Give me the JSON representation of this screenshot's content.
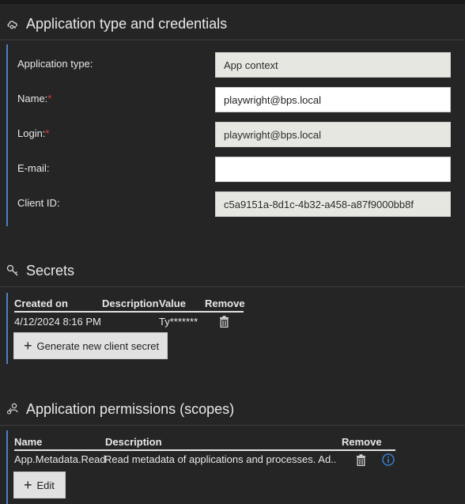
{
  "credentials": {
    "section_title": "Application type and credentials",
    "app_type_label": "Application type:",
    "app_type_value": "App context",
    "name_label": "Name:",
    "name_value": "playwright@bps.local",
    "login_label": "Login:",
    "login_value": "playwright@bps.local",
    "email_label": "E-mail:",
    "email_value": "",
    "client_id_label": "Client ID:",
    "client_id_value": "c5a9151a-8d1c-4b32-a458-a87f9000bb8f",
    "required_marker": "*"
  },
  "secrets": {
    "section_title": "Secrets",
    "columns": [
      "Created on",
      "Description",
      "Value",
      "Remove"
    ],
    "rows": [
      {
        "created_on": "4/12/2024 8:16 PM",
        "description": "",
        "value": "Ty*******"
      }
    ],
    "generate_button_label": "Generate new client secret"
  },
  "permissions": {
    "section_title": "Application permissions (scopes)",
    "columns": [
      "Name",
      "Description",
      "Remove"
    ],
    "rows": [
      {
        "name": "App.Metadata.Read",
        "description": "Read metadata of applications and processes. Ad..."
      }
    ],
    "edit_button_label": "Edit"
  },
  "icons": {
    "credentials": "cloud-key-icon",
    "secrets": "key-icon",
    "permissions": "user-permissions-icon",
    "remove": "trash-icon",
    "info": "info-icon"
  },
  "colors": {
    "background": "#252526",
    "accent": "#4d7fc4",
    "required": "#e04040",
    "info": "#3a8ee6"
  }
}
